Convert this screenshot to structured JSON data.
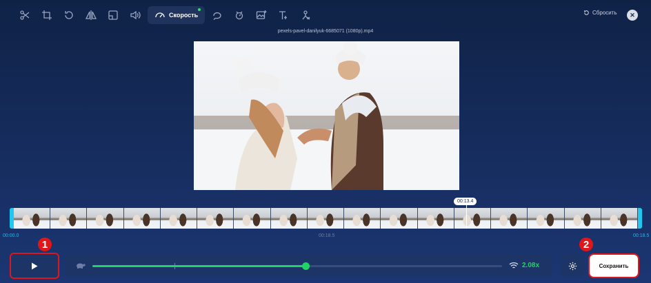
{
  "toolbar": {
    "tools": [
      "scissors-icon",
      "crop-icon",
      "rotate-icon",
      "flip-icon",
      "resize-icon",
      "volume-icon"
    ],
    "speed_label": "Скорость",
    "tools_after": [
      "loop-icon",
      "stabilize-icon",
      "add-image-icon",
      "add-text-icon",
      "remove-watermark-icon"
    ],
    "reset_label": "Сбросить"
  },
  "video": {
    "filename": "pexels-pavel-danilyuk-6685071 (1080p).mp4"
  },
  "timeline": {
    "start_time": "00:00.0",
    "mid_time": "00:18.5",
    "end_time": "00:18.5",
    "current_time": "00:13.4",
    "thumbnail_count": 17
  },
  "annotations": {
    "badge1": "1",
    "badge2": "2"
  },
  "speed": {
    "value_label": "2.08x",
    "position_fraction": 0.52,
    "marker_fraction": 0.2
  },
  "actions": {
    "save_label": "Сохранить"
  },
  "colors": {
    "accent_green": "#22d266",
    "accent_cyan": "#20c8f0",
    "highlight_red": "#e0161b"
  }
}
